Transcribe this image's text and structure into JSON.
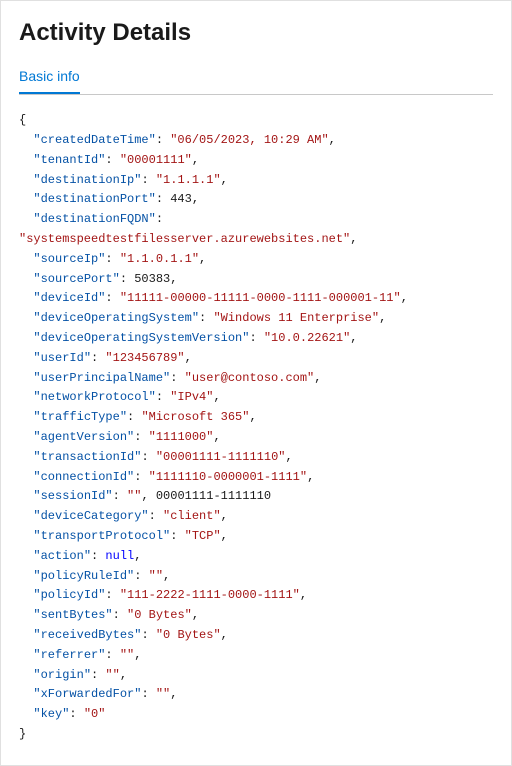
{
  "header": {
    "title": "Activity Details"
  },
  "tabs": [
    {
      "label": "Basic info",
      "active": true
    }
  ],
  "json_data": {
    "createdDateTime": "06/05/2023, 10:29 AM",
    "tenantId": "00001111",
    "destinationIp": "1.1.1.1",
    "destinationPort": 443,
    "destinationFQDN": "systemspeedtestfilesserver.azurewebsites.net",
    "sourceIp": "1.1.0.1.1",
    "sourcePort": 50383,
    "deviceId": "11111-00000-11111-0000-1111-000001-11",
    "deviceOperatingSystem": "Windows 11 Enterprise",
    "deviceOperatingSystemVersion": "10.0.22621",
    "userId": "123456789",
    "userPrincipalName": "user@contoso.com",
    "networkProtocol": "IPv4",
    "trafficType": "Microsoft 365",
    "agentVersion": "1111000",
    "transactionId": "00001111-1111110",
    "connectionId": "1111110-0000001-1111",
    "sessionId": "00001111-1111110",
    "deviceCategory": "client",
    "transportProtocol": "TCP",
    "action": null,
    "policyRuleId": "",
    "policyId": "111-2222-1111-0000-1111",
    "sentBytes": "0 Bytes",
    "receivedBytes": "0 Bytes",
    "referrer": "",
    "origin": "",
    "xForwardedFor": "",
    "key": "0"
  }
}
